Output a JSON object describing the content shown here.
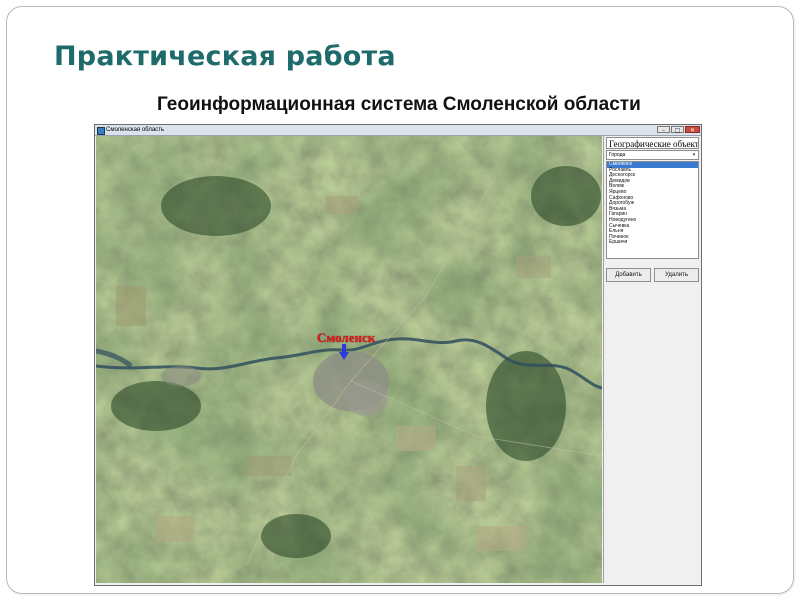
{
  "slide": {
    "title": "Практическая работа",
    "subtitle": "Геоинформационная система Смоленской области"
  },
  "window": {
    "title": "Смоленская область",
    "buttons": {
      "minimize": "–",
      "maximize": "□",
      "close": "✕"
    }
  },
  "map": {
    "city_label": "Смоленск",
    "marker_icon": "down-arrow-icon",
    "marker_color": "#2a3ddc",
    "label_color": "#e01818"
  },
  "panel": {
    "header": "Географические объекты",
    "combo_value": "Города",
    "list_items": [
      "Смоленск",
      "Рославль",
      "Десногорск",
      "Демидов",
      "Велиж",
      "Ярцево",
      "Сафоново",
      "Дорогобуж",
      "Вязьма",
      "Гагарин",
      "Новодугино",
      "Сычевка",
      "Ельня",
      "Починок",
      "Ершичи"
    ],
    "selected_index": 0,
    "add_button": "Добавить",
    "delete_button": "Удалить"
  },
  "colors": {
    "title_teal": "#1f6b6b",
    "selection": "#3a79d0"
  }
}
